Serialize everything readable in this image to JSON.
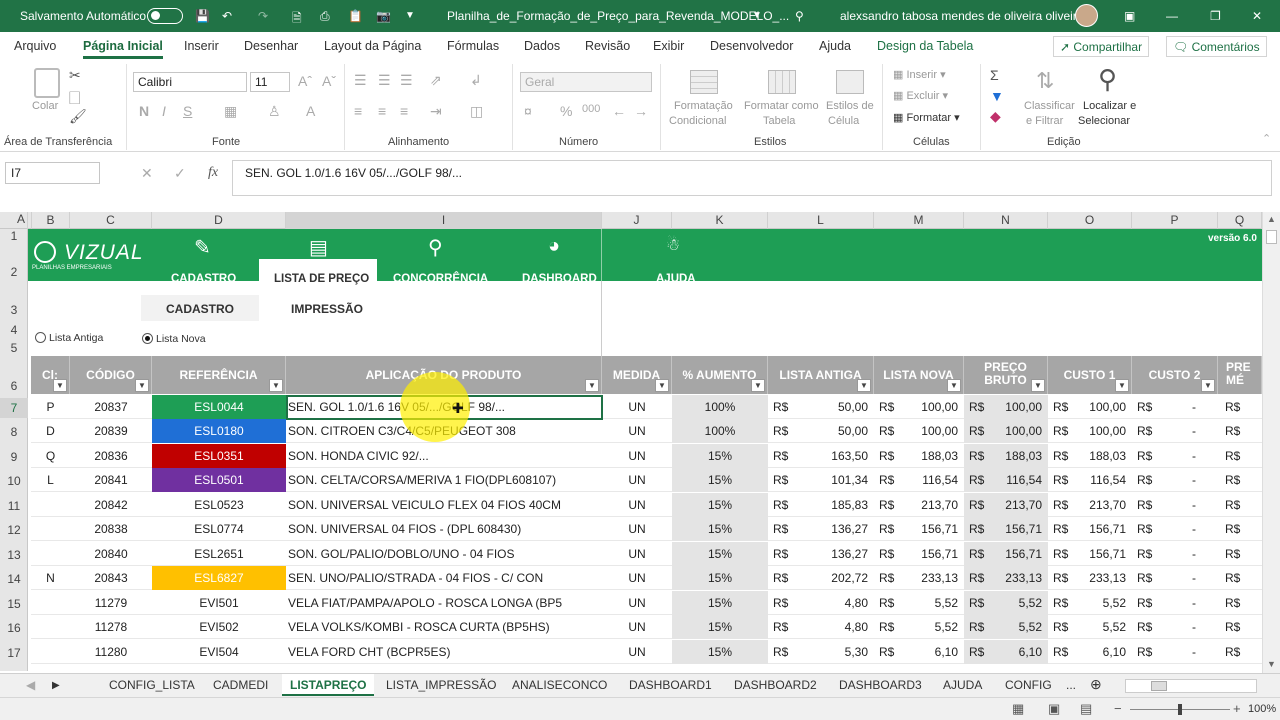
{
  "titlebar": {
    "autosave": "Salvamento Automático",
    "filename": "Planilha_de_Formação_de_Preço_para_Revenda_MODELO_...",
    "user": "alexsandro tabosa mendes de oliveira oliveira"
  },
  "ribbon_tabs": [
    "Arquivo",
    "Página Inicial",
    "Inserir",
    "Desenhar",
    "Layout da Página",
    "Fórmulas",
    "Dados",
    "Revisão",
    "Exibir",
    "Desenvolvedor",
    "Ajuda",
    "Design da Tabela"
  ],
  "share_label": "Compartilhar",
  "comments_label": "Comentários",
  "ribbon": {
    "paste": "Colar",
    "font_name": "Calibri",
    "font_size": "11",
    "number_format": "Geral",
    "cond_format_1": "Formatação",
    "cond_format_2": "Condicional",
    "format_table_1": "Formatar como",
    "format_table_2": "Tabela",
    "cell_styles_1": "Estilos de",
    "cell_styles_2": "Célula",
    "insert": "Inserir",
    "delete": "Excluir",
    "format": "Formatar",
    "sort_1": "Classificar",
    "sort_2": "e Filtrar",
    "find_1": "Localizar e",
    "find_2": "Selecionar",
    "groups": [
      "Área de Transferência",
      "Fonte",
      "Alinhamento",
      "Número",
      "Estilos",
      "Células",
      "Edição"
    ]
  },
  "formula_bar": {
    "name_box": "I7",
    "formula": "SEN. GOL 1.0/1.6 16V 05/.../GOLF 98/..."
  },
  "columns": [
    "A",
    "B",
    "C",
    "D",
    "I",
    "J",
    "K",
    "L",
    "M",
    "N",
    "O",
    "P",
    "Q"
  ],
  "rows": [
    "1",
    "2",
    "3",
    "4",
    "5",
    "6",
    "7",
    "8",
    "9",
    "10",
    "11",
    "12",
    "13",
    "14",
    "15",
    "16",
    "17"
  ],
  "sheet": {
    "logo": "VIZUAL",
    "logo_sub": "PLANILHAS EMPRESARIAIS",
    "version": "versão 6.0",
    "nav": [
      "CADASTRO",
      "LISTA DE PREÇO",
      "CONCORRÊNCIA",
      "DASHBOARD",
      "AJUDA"
    ],
    "subtabs": [
      "CADASTRO",
      "IMPRESSÃO"
    ],
    "radio_old": "Lista Antiga",
    "radio_new": "Lista Nova"
  },
  "table": {
    "headers": [
      "Cl:",
      "CÓDIGO",
      "REFERÊNCIA",
      "APLICAÇÃO DO PRODUTO",
      "MEDIDA",
      "% AUMENTO",
      "LISTA ANTIGA",
      "LISTA NOVA",
      "PREÇO BRUTO",
      "CUSTO 1",
      "CUSTO 2",
      "PRE MÉ"
    ],
    "rows": [
      {
        "cl": "P",
        "code": "20837",
        "ref": "ESL0044",
        "ref_color": "#1e9e55",
        "app": "SEN. GOL 1.0/1.6 16V 05/.../GOLF 98/...",
        "medida": "UN",
        "aumento": "100%",
        "antiga": "50,00",
        "nova": "100,00",
        "bruto": "100,00",
        "custo1": "100,00",
        "custo2": "-"
      },
      {
        "cl": "D",
        "code": "20839",
        "ref": "ESL0180",
        "ref_color": "#1f6fd6",
        "app": "SON. CITROEN C3/C4/C5/PEUGEOT 308",
        "medida": "UN",
        "aumento": "100%",
        "antiga": "50,00",
        "nova": "100,00",
        "bruto": "100,00",
        "custo1": "100,00",
        "custo2": "-"
      },
      {
        "cl": "Q",
        "code": "20836",
        "ref": "ESL0351",
        "ref_color": "#c00000",
        "app": "SON. HONDA CIVIC 92/...",
        "medida": "UN",
        "aumento": "15%",
        "antiga": "163,50",
        "nova": "188,03",
        "bruto": "188,03",
        "custo1": "188,03",
        "custo2": "-"
      },
      {
        "cl": "L",
        "code": "20841",
        "ref": "ESL0501",
        "ref_color": "#7030a0",
        "app": "SON. CELTA/CORSA/MERIVA 1 FIO(DPL608107)",
        "medida": "UN",
        "aumento": "15%",
        "antiga": "101,34",
        "nova": "116,54",
        "bruto": "116,54",
        "custo1": "116,54",
        "custo2": "-"
      },
      {
        "cl": "",
        "code": "20842",
        "ref": "ESL0523",
        "ref_color": "",
        "app": "SON. UNIVERSAL VEICULO FLEX 04 FIOS 40CM",
        "medida": "UN",
        "aumento": "15%",
        "antiga": "185,83",
        "nova": "213,70",
        "bruto": "213,70",
        "custo1": "213,70",
        "custo2": "-"
      },
      {
        "cl": "",
        "code": "20838",
        "ref": "ESL0774",
        "ref_color": "",
        "app": "SON. UNIVERSAL 04 FIOS - (DPL 608430)",
        "medida": "UN",
        "aumento": "15%",
        "antiga": "136,27",
        "nova": "156,71",
        "bruto": "156,71",
        "custo1": "156,71",
        "custo2": "-"
      },
      {
        "cl": "",
        "code": "20840",
        "ref": "ESL2651",
        "ref_color": "",
        "app": "SON. GOL/PALIO/DOBLO/UNO - 04 FIOS",
        "medida": "UN",
        "aumento": "15%",
        "antiga": "136,27",
        "nova": "156,71",
        "bruto": "156,71",
        "custo1": "156,71",
        "custo2": "-"
      },
      {
        "cl": "N",
        "code": "20843",
        "ref": "ESL6827",
        "ref_color": "#ffc000",
        "app": "SEN. UNO/PALIO/STRADA - 04 FIOS - C/ CON",
        "medida": "UN",
        "aumento": "15%",
        "antiga": "202,72",
        "nova": "233,13",
        "bruto": "233,13",
        "custo1": "233,13",
        "custo2": "-"
      },
      {
        "cl": "",
        "code": "11279",
        "ref": "EVI501",
        "ref_color": "",
        "app": "VELA FIAT/PAMPA/APOLO - ROSCA LONGA (BP5",
        "medida": "UN",
        "aumento": "15%",
        "antiga": "4,80",
        "nova": "5,52",
        "bruto": "5,52",
        "custo1": "5,52",
        "custo2": "-"
      },
      {
        "cl": "",
        "code": "11278",
        "ref": "EVI502",
        "ref_color": "",
        "app": "VELA VOLKS/KOMBI - ROSCA CURTA (BP5HS)",
        "medida": "UN",
        "aumento": "15%",
        "antiga": "4,80",
        "nova": "5,52",
        "bruto": "5,52",
        "custo1": "5,52",
        "custo2": "-"
      },
      {
        "cl": "",
        "code": "11280",
        "ref": "EVI504",
        "ref_color": "",
        "app": "VELA FORD CHT (BCPR5ES)",
        "medida": "UN",
        "aumento": "15%",
        "antiga": "5,30",
        "nova": "6,10",
        "bruto": "6,10",
        "custo1": "6,10",
        "custo2": "-"
      }
    ],
    "currency": "R$"
  },
  "sheet_tabs": [
    "CONFIG_LISTA",
    "CADMEDI",
    "LISTAPREÇO",
    "LISTA_IMPRESSÃO",
    "ANALISECONCO",
    "DASHBOARD1",
    "DASHBOARD2",
    "DASHBOARD3",
    "AJUDA",
    "CONFIG",
    "..."
  ],
  "zoom": "100%"
}
